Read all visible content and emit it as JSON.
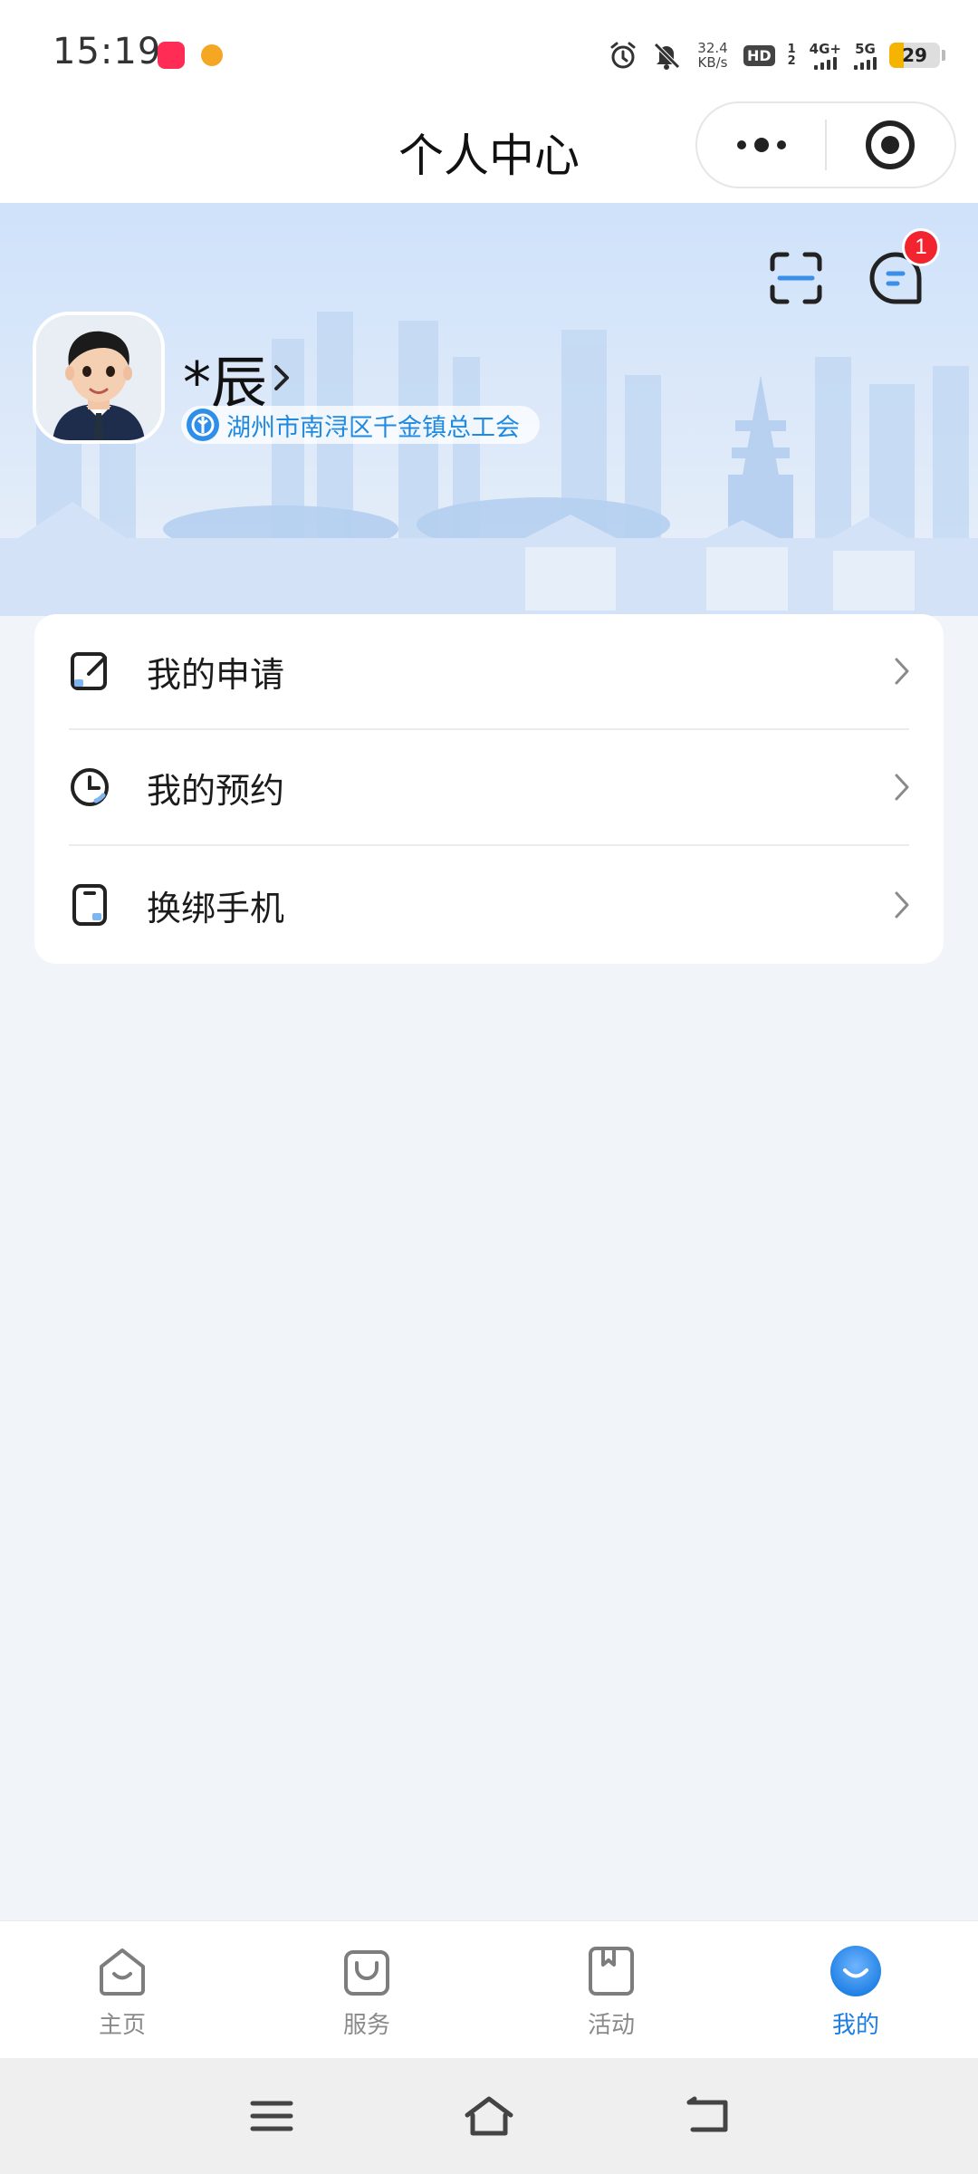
{
  "status_bar": {
    "time": "15:19",
    "network_speed_value": "32.4",
    "network_speed_unit": "KB/s",
    "hd_label": "HD",
    "sim_label": "1 2",
    "net_4g": "4G+",
    "net_5g": "5G",
    "battery_level": "29",
    "battery_fraction": 0.29,
    "icons": [
      "alarm-icon",
      "bell-muted-icon",
      "signal-icon",
      "battery-icon"
    ]
  },
  "nav": {
    "title": "个人中心",
    "capsule_icons": [
      "more-icon",
      "target-icon"
    ]
  },
  "header": {
    "user_name": "*辰",
    "organization": "湖州市南浔区千金镇总工会",
    "message_badge_count": "1",
    "icons": [
      "scan-icon",
      "message-icon"
    ],
    "accent_color": "#1c7ee3",
    "badge_color": "#f1242f"
  },
  "menu": {
    "items": [
      {
        "label": "我的申请",
        "icon": "edit-icon"
      },
      {
        "label": "我的预约",
        "icon": "clock-icon"
      },
      {
        "label": "换绑手机",
        "icon": "phone-icon"
      }
    ]
  },
  "tab_bar": {
    "tabs": [
      {
        "label": "主页",
        "icon": "home-icon",
        "active": false
      },
      {
        "label": "服务",
        "icon": "bag-icon",
        "active": false
      },
      {
        "label": "活动",
        "icon": "bookmark-icon",
        "active": false
      },
      {
        "label": "我的",
        "icon": "profile-icon",
        "active": true
      }
    ],
    "active_color": "#1c7ee3",
    "inactive_color": "#8a8a8a"
  },
  "system_nav": {
    "icons": [
      "menu-icon",
      "home-outline-icon",
      "back-icon"
    ]
  }
}
